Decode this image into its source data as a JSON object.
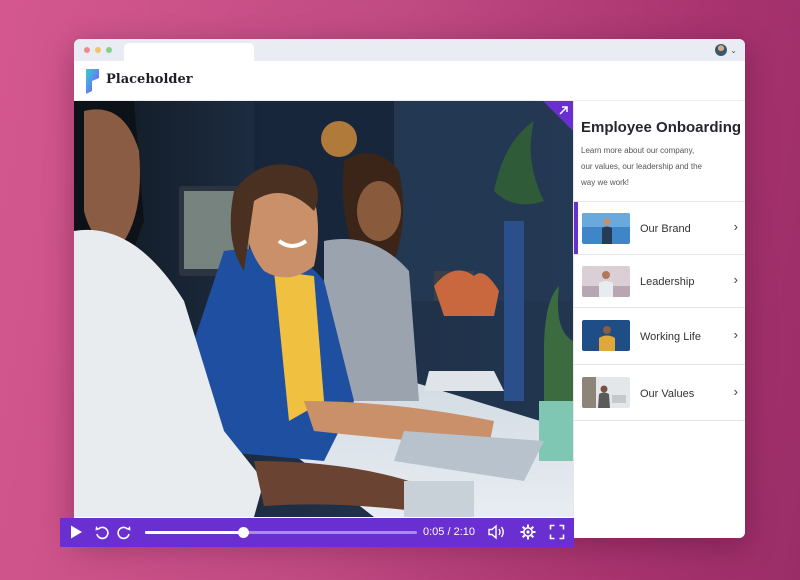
{
  "app": {
    "brand": "Placeholder",
    "accent_color": "#6a2fd0"
  },
  "video": {
    "current_time": "0:05",
    "duration": "2:10",
    "time_display": "0:05 / 2:10",
    "progress": 0.36
  },
  "sidebar": {
    "title": "Employee Onboarding",
    "description_lines": [
      "Learn more about our company,",
      "our values, our leadership and the",
      "way we work!"
    ],
    "items": [
      {
        "label": "Our Brand",
        "active": true
      },
      {
        "label": "Leadership",
        "active": false
      },
      {
        "label": "Working Life",
        "active": false
      },
      {
        "label": "Our Values",
        "active": false
      }
    ]
  },
  "icons": {
    "play": "play-icon",
    "rewind": "rewind-icon",
    "forward": "forward-icon",
    "volume": "volume-icon",
    "settings": "gear-icon",
    "fullscreen": "fullscreen-icon",
    "expand": "expand-arrow-icon",
    "chevron": "chevron-right-icon"
  }
}
